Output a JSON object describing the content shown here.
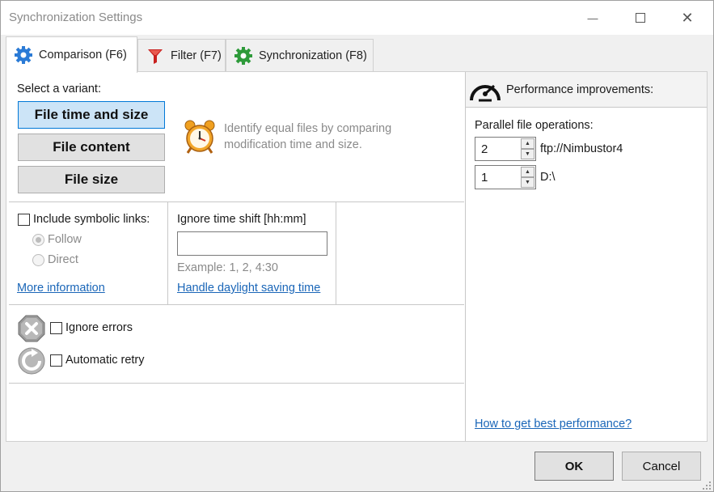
{
  "window": {
    "title": "Synchronization Settings",
    "minimize_glyph": "—",
    "maximize_glyph": "☐",
    "close_glyph": "✕"
  },
  "tabs": [
    {
      "label": "Comparison (F6)",
      "icon": "gear-icon",
      "active": true
    },
    {
      "label": "Filter (F7)",
      "icon": "funnel-icon",
      "active": false
    },
    {
      "label": "Synchronization (F8)",
      "icon": "gear-green-icon",
      "active": false
    }
  ],
  "comparison": {
    "select_variant_label": "Select a variant:",
    "variants": [
      {
        "label": "File time and size",
        "selected": true
      },
      {
        "label": "File content",
        "selected": false
      },
      {
        "label": "File size",
        "selected": false
      }
    ],
    "description_line1": "Identify equal files by comparing",
    "description_line2": "modification time and size.",
    "symlinks_label": "Include symbolic links:",
    "follow_label": "Follow",
    "direct_label": "Direct",
    "more_info_link": "More information",
    "time_shift_label": "Ignore time shift [hh:mm]",
    "time_shift_value": "",
    "time_shift_example": "Example: 1, 2, 4:30",
    "daylight_link": "Handle daylight saving time",
    "ignore_errors_label": "Ignore errors",
    "auto_retry_label": "Automatic retry"
  },
  "performance": {
    "header": "Performance improvements:",
    "parallel_label": "Parallel file operations:",
    "rows": [
      {
        "value": "2",
        "target": "ftp://Nimbustor4"
      },
      {
        "value": "1",
        "target": "D:\\"
      }
    ],
    "help_link": "How to get best performance?"
  },
  "footer": {
    "ok_label": "OK",
    "cancel_label": "Cancel"
  },
  "colors": {
    "accent": "#0078d7",
    "link": "#1a66b8",
    "selected_bg": "#cce4f7"
  }
}
